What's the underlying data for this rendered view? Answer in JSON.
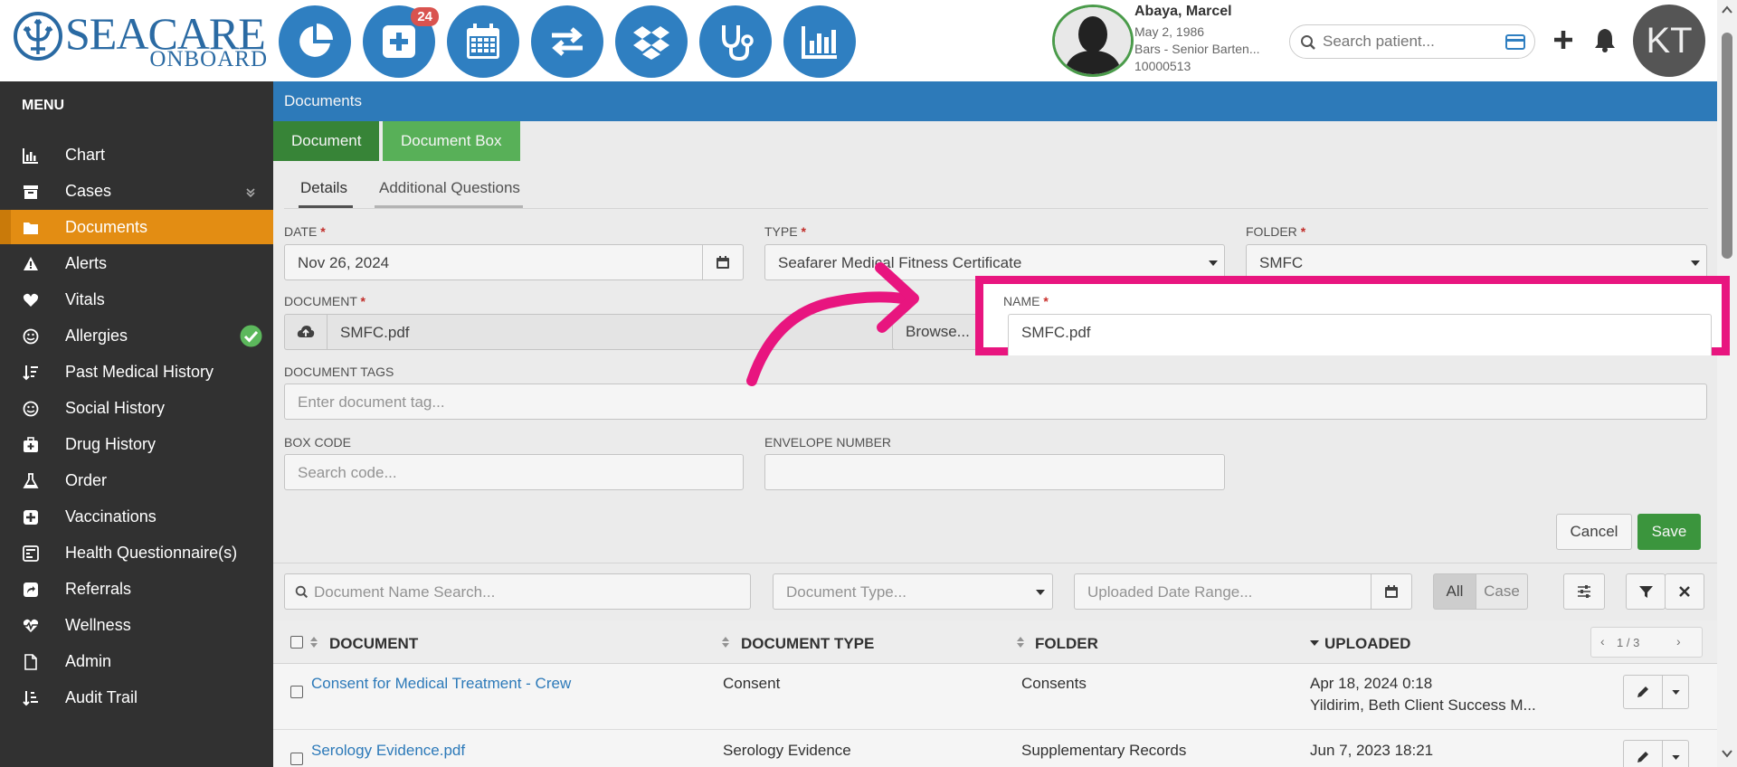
{
  "header": {
    "logo_main": "SEACARE",
    "logo_sub": "ONBOARD",
    "badge_count": "24",
    "patient": {
      "name": "Abaya, Marcel",
      "dob": "May 2, 1986",
      "role": "Bars - Senior Barten...",
      "id": "10000513"
    },
    "search_placeholder": "Search patient...",
    "avatar_initials": "KT"
  },
  "sidebar": {
    "title": "MENU",
    "items": [
      {
        "label": "Chart",
        "icon": "bar-chart-icon"
      },
      {
        "label": "Cases",
        "icon": "archive-icon"
      },
      {
        "label": "Documents",
        "icon": "folder-icon"
      },
      {
        "label": "Alerts",
        "icon": "warning-icon"
      },
      {
        "label": "Vitals",
        "icon": "heart-icon"
      },
      {
        "label": "Allergies",
        "icon": "smile-icon"
      },
      {
        "label": "Past Medical History",
        "icon": "sort-icon"
      },
      {
        "label": "Social History",
        "icon": "smile-icon"
      },
      {
        "label": "Drug History",
        "icon": "medkit-icon"
      },
      {
        "label": "Order",
        "icon": "flask-icon"
      },
      {
        "label": "Vaccinations",
        "icon": "plus-square-icon"
      },
      {
        "label": "Health Questionnaire(s)",
        "icon": "form-icon"
      },
      {
        "label": "Referrals",
        "icon": "share-icon"
      },
      {
        "label": "Wellness",
        "icon": "heartbeat-icon"
      },
      {
        "label": "Admin",
        "icon": "file-icon"
      },
      {
        "label": "Audit Trail",
        "icon": "list-icon"
      }
    ]
  },
  "main": {
    "breadcrumb": "Documents",
    "tabs": [
      "Document",
      "Document Box"
    ],
    "subtabs": [
      "Details",
      "Additional Questions"
    ],
    "form": {
      "date_label": "DATE",
      "date_value": "Nov 26, 2024",
      "type_label": "TYPE",
      "type_value": "Seafarer Medical Fitness Certificate",
      "folder_label": "FOLDER",
      "folder_value": "SMFC",
      "document_label": "DOCUMENT",
      "document_value": "SMFC.pdf",
      "browse_label": "Browse...",
      "name_label": "NAME",
      "name_value": "SMFC.pdf",
      "tags_label": "DOCUMENT TAGS",
      "tags_placeholder": "Enter document tag...",
      "box_label": "BOX CODE",
      "box_placeholder": "Search code...",
      "envelope_label": "ENVELOPE NUMBER",
      "cancel_label": "Cancel",
      "save_label": "Save"
    },
    "filters": {
      "name_search_placeholder": "Document Name Search...",
      "type_placeholder": "Document Type...",
      "date_range_placeholder": "Uploaded Date Range...",
      "all_label": "All",
      "case_label": "Case"
    },
    "table": {
      "headers": [
        "DOCUMENT",
        "DOCUMENT TYPE",
        "FOLDER",
        "UPLOADED"
      ],
      "pagination": "1 / 3",
      "rows": [
        {
          "document": "Consent for Medical Treatment - Crew",
          "type": "Consent",
          "folder": "Consents",
          "uploaded": "Apr 18, 2024 0:18",
          "uploaded_by": "Yildirim, Beth Client Success M..."
        },
        {
          "document": "Serology Evidence.pdf",
          "type": "Serology Evidence",
          "folder": "Supplementary Records",
          "uploaded": "Jun 7, 2023 18:21",
          "uploaded_by": ""
        }
      ]
    }
  },
  "colors": {
    "brand_blue": "#2f7fc1",
    "active_orange": "#e38d13",
    "highlight_pink": "#e8157f",
    "save_green": "#3e9c40"
  }
}
